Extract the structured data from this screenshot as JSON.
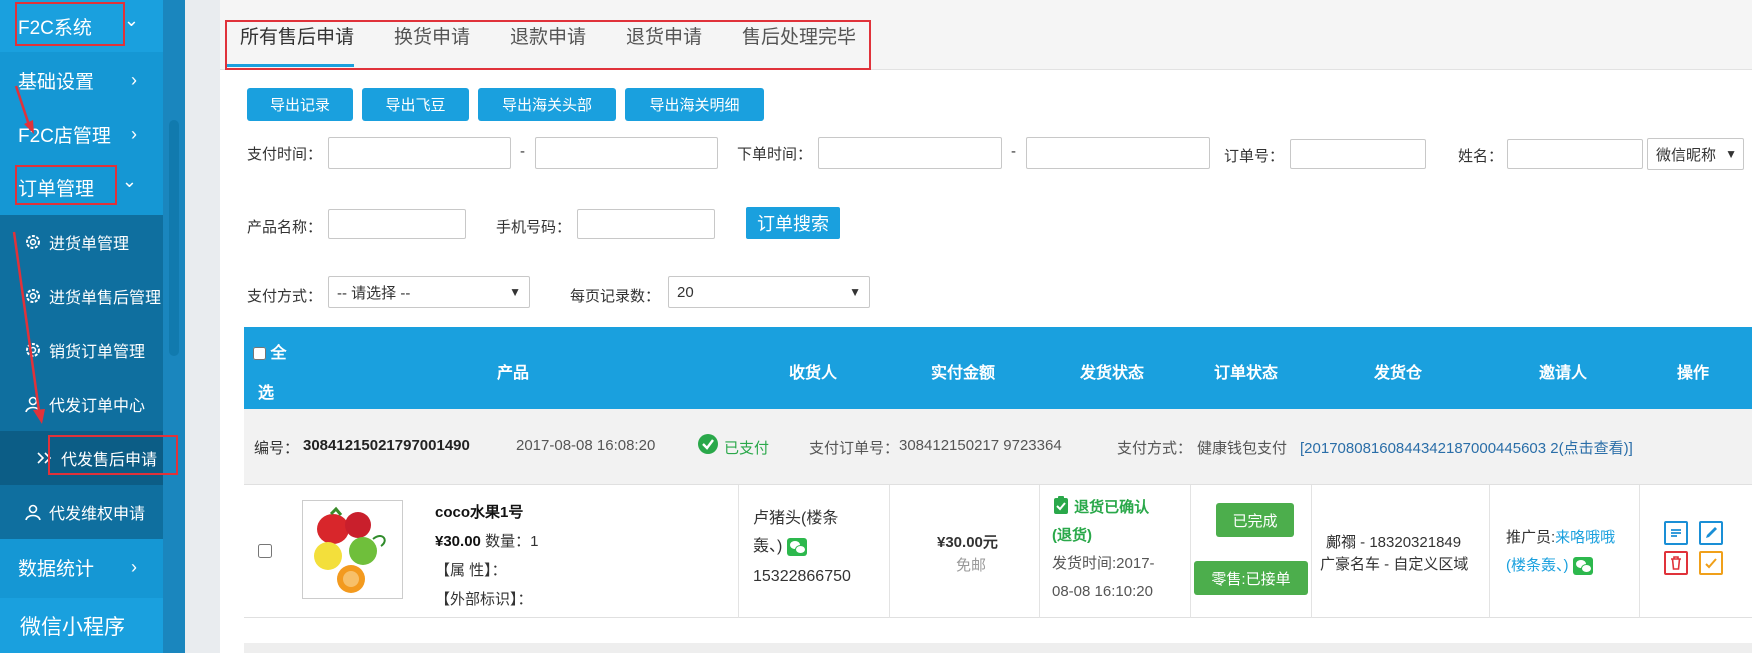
{
  "sidebar": {
    "system_title": "F2C系统",
    "items": [
      {
        "label": "基础设置"
      },
      {
        "label": "F2C店管理"
      },
      {
        "label": "订单管理"
      }
    ],
    "sub_items": [
      {
        "label": "进货单管理",
        "icon": "gear-icon"
      },
      {
        "label": "进货单售后管理",
        "icon": "gear-icon"
      },
      {
        "label": "销货订单管理",
        "icon": "gear-icon"
      },
      {
        "label": "代发订单中心",
        "icon": "user-icon"
      },
      {
        "label": "代发售后申请",
        "icon": "double-chevron-icon"
      },
      {
        "label": "代发维权申请",
        "icon": "user-icon"
      }
    ],
    "stats_label": "数据统计",
    "mini_program_label": "微信小程序",
    "chevron": "›",
    "chevron_down": "⌄"
  },
  "tabs": [
    "所有售后申请",
    "换货申请",
    "退款申请",
    "退货申请",
    "售后处理完毕"
  ],
  "export_buttons": [
    "导出记录",
    "导出飞豆",
    "导出海关头部",
    "导出海关明细"
  ],
  "filters": {
    "pay_time_label": "支付时间：",
    "dash": "-",
    "order_time_label": "下单时间：",
    "order_no_label": "订单号：",
    "name_label": "姓名：",
    "name_type": "微信昵称",
    "product_name_label": "产品名称：",
    "phone_label": "手机号码：",
    "search_button": "订单搜索",
    "pay_method_label": "支付方式：",
    "pay_method_value": "-- 请选择 --",
    "page_size_label": "每页记录数：",
    "page_size_value": "20"
  },
  "table": {
    "select_all": "全",
    "select_all_2": "选",
    "headers": [
      "产品",
      "收货人",
      "实付金额",
      "发货状态",
      "订单状态",
      "发货仓",
      "邀请人",
      "操作"
    ]
  },
  "order": {
    "number_label": "编号：",
    "number": "30841215021797001490",
    "time": "2017-08-08 16:08:20",
    "paid_status": "已支付",
    "pay_order_no_label": "支付订单号：",
    "pay_order_no": "308412150217 9723364",
    "pay_method_label": "支付方式：",
    "pay_method": "健康钱包支付",
    "pay_link": "[20170808160844342187000445603 2(点击查看)]",
    "product_name": "coco水果1号",
    "price": "¥30.00",
    "quantity_label": "数量：",
    "quantity": "1",
    "attr_label": "【属 性】：",
    "ext_label": "【外部标识】：",
    "receiver_name": "卢猪头(楼条",
    "receiver_name_2": "轰、)",
    "receiver_phone": "15322866750",
    "amount": "¥30.00元",
    "shipping_note": "免邮",
    "ship_status": "退货已确认",
    "ship_status_2": "(退货)",
    "ship_time_1": "发货时间:2017-",
    "ship_time_2": "08-08 16:10:20",
    "order_status_btn": "已完成",
    "retail_btn": "零售:已接单",
    "warehouse_1": "鄺禤 - 18320321849",
    "warehouse_2": "广豪名车 - 自定义区域",
    "inviter_label": "推广员:",
    "inviter_name": "来咯哦哦",
    "inviter_name_2": "(楼条轰、)"
  },
  "colors": {
    "accent": "#1aa0de",
    "sidebar": "#1597d4",
    "sidebar_sub": "#0f6f9f",
    "green": "#4cae4c",
    "annotation_red": "#e0323a"
  }
}
